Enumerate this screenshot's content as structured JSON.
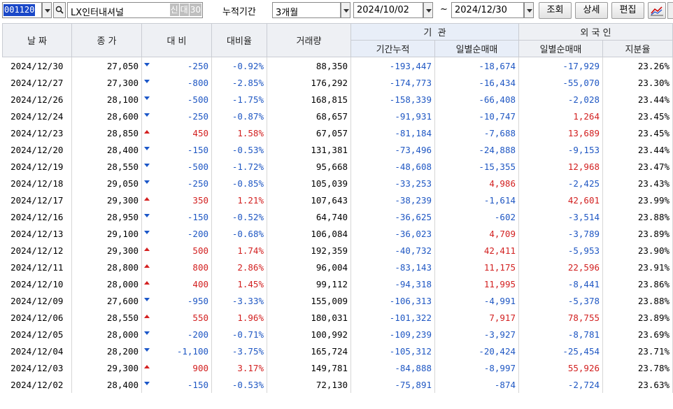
{
  "toolbar": {
    "code": "001120",
    "company": "LX인터내셔널",
    "tag1": "신",
    "tag2": "대",
    "tag3": "30",
    "period_label": "누적기간",
    "period_value": "3개월",
    "date_from": "2024/10/02",
    "tilde": "~",
    "date_to": "2024/12/30",
    "query_btn": "조회",
    "detail_btn": "상세",
    "edit_btn": "편집"
  },
  "headers": {
    "date": "날 짜",
    "close": "종 가",
    "change": "대 비",
    "rate": "대비율",
    "volume": "거래량",
    "inst": "기  관",
    "inst_cum": "기간누적",
    "inst_daily": "일별순매매",
    "foreign": "외 국 인",
    "foreign_daily": "일별순매매",
    "foreign_ratio": "지분율"
  },
  "rows": [
    {
      "date": "2024/12/30",
      "close": "27,050",
      "dir": "down",
      "change": "-250",
      "rate": "-0.92%",
      "volume": "88,350",
      "inst_cum": "-193,447",
      "inst_daily": "-18,674",
      "for_daily": "-17,929",
      "ratio": "23.26%"
    },
    {
      "date": "2024/12/27",
      "close": "27,300",
      "dir": "down",
      "change": "-800",
      "rate": "-2.85%",
      "volume": "176,292",
      "inst_cum": "-174,773",
      "inst_daily": "-16,434",
      "for_daily": "-55,070",
      "ratio": "23.30%"
    },
    {
      "date": "2024/12/26",
      "close": "28,100",
      "dir": "down",
      "change": "-500",
      "rate": "-1.75%",
      "volume": "168,815",
      "inst_cum": "-158,339",
      "inst_daily": "-66,408",
      "for_daily": "-2,028",
      "ratio": "23.44%"
    },
    {
      "date": "2024/12/24",
      "close": "28,600",
      "dir": "down",
      "change": "-250",
      "rate": "-0.87%",
      "volume": "68,657",
      "inst_cum": "-91,931",
      "inst_daily": "-10,747",
      "for_daily": "1,264",
      "ratio": "23.45%"
    },
    {
      "date": "2024/12/23",
      "close": "28,850",
      "dir": "up",
      "change": "450",
      "rate": "1.58%",
      "volume": "67,057",
      "inst_cum": "-81,184",
      "inst_daily": "-7,688",
      "for_daily": "13,689",
      "ratio": "23.45%"
    },
    {
      "date": "2024/12/20",
      "close": "28,400",
      "dir": "down",
      "change": "-150",
      "rate": "-0.53%",
      "volume": "131,381",
      "inst_cum": "-73,496",
      "inst_daily": "-24,888",
      "for_daily": "-9,153",
      "ratio": "23.44%"
    },
    {
      "date": "2024/12/19",
      "close": "28,550",
      "dir": "down",
      "change": "-500",
      "rate": "-1.72%",
      "volume": "95,668",
      "inst_cum": "-48,608",
      "inst_daily": "-15,355",
      "for_daily": "12,968",
      "ratio": "23.47%"
    },
    {
      "date": "2024/12/18",
      "close": "29,050",
      "dir": "down",
      "change": "-250",
      "rate": "-0.85%",
      "volume": "105,039",
      "inst_cum": "-33,253",
      "inst_daily": "4,986",
      "for_daily": "-2,425",
      "ratio": "23.43%"
    },
    {
      "date": "2024/12/17",
      "close": "29,300",
      "dir": "up",
      "change": "350",
      "rate": "1.21%",
      "volume": "107,643",
      "inst_cum": "-38,239",
      "inst_daily": "-1,614",
      "for_daily": "42,601",
      "ratio": "23.99%"
    },
    {
      "date": "2024/12/16",
      "close": "28,950",
      "dir": "down",
      "change": "-150",
      "rate": "-0.52%",
      "volume": "64,740",
      "inst_cum": "-36,625",
      "inst_daily": "-602",
      "for_daily": "-3,514",
      "ratio": "23.88%"
    },
    {
      "date": "2024/12/13",
      "close": "29,100",
      "dir": "down",
      "change": "-200",
      "rate": "-0.68%",
      "volume": "106,084",
      "inst_cum": "-36,023",
      "inst_daily": "4,709",
      "for_daily": "-3,789",
      "ratio": "23.89%"
    },
    {
      "date": "2024/12/12",
      "close": "29,300",
      "dir": "up",
      "change": "500",
      "rate": "1.74%",
      "volume": "192,359",
      "inst_cum": "-40,732",
      "inst_daily": "42,411",
      "for_daily": "-5,953",
      "ratio": "23.90%"
    },
    {
      "date": "2024/12/11",
      "close": "28,800",
      "dir": "up",
      "change": "800",
      "rate": "2.86%",
      "volume": "96,004",
      "inst_cum": "-83,143",
      "inst_daily": "11,175",
      "for_daily": "22,596",
      "ratio": "23.91%"
    },
    {
      "date": "2024/12/10",
      "close": "28,000",
      "dir": "up",
      "change": "400",
      "rate": "1.45%",
      "volume": "99,112",
      "inst_cum": "-94,318",
      "inst_daily": "11,995",
      "for_daily": "-8,441",
      "ratio": "23.86%"
    },
    {
      "date": "2024/12/09",
      "close": "27,600",
      "dir": "down",
      "change": "-950",
      "rate": "-3.33%",
      "volume": "155,009",
      "inst_cum": "-106,313",
      "inst_daily": "-4,991",
      "for_daily": "-5,378",
      "ratio": "23.88%"
    },
    {
      "date": "2024/12/06",
      "close": "28,550",
      "dir": "up",
      "change": "550",
      "rate": "1.96%",
      "volume": "180,031",
      "inst_cum": "-101,322",
      "inst_daily": "7,917",
      "for_daily": "78,755",
      "ratio": "23.89%"
    },
    {
      "date": "2024/12/05",
      "close": "28,000",
      "dir": "down",
      "change": "-200",
      "rate": "-0.71%",
      "volume": "100,992",
      "inst_cum": "-109,239",
      "inst_daily": "-3,927",
      "for_daily": "-8,781",
      "ratio": "23.69%"
    },
    {
      "date": "2024/12/04",
      "close": "28,200",
      "dir": "down",
      "change": "-1,100",
      "rate": "-3.75%",
      "volume": "165,724",
      "inst_cum": "-105,312",
      "inst_daily": "-20,424",
      "for_daily": "-25,454",
      "ratio": "23.71%"
    },
    {
      "date": "2024/12/03",
      "close": "29,300",
      "dir": "up",
      "change": "900",
      "rate": "3.17%",
      "volume": "149,781",
      "inst_cum": "-84,888",
      "inst_daily": "-8,997",
      "for_daily": "55,926",
      "ratio": "23.78%"
    },
    {
      "date": "2024/12/02",
      "close": "28,400",
      "dir": "down",
      "change": "-150",
      "rate": "-0.53%",
      "volume": "72,130",
      "inst_cum": "-75,891",
      "inst_daily": "-874",
      "for_daily": "-2,724",
      "ratio": "23.63%"
    }
  ],
  "colors": {
    "negative": "#1f57c3",
    "positive": "#d21f1f",
    "header_bg": "#eef0f4"
  }
}
